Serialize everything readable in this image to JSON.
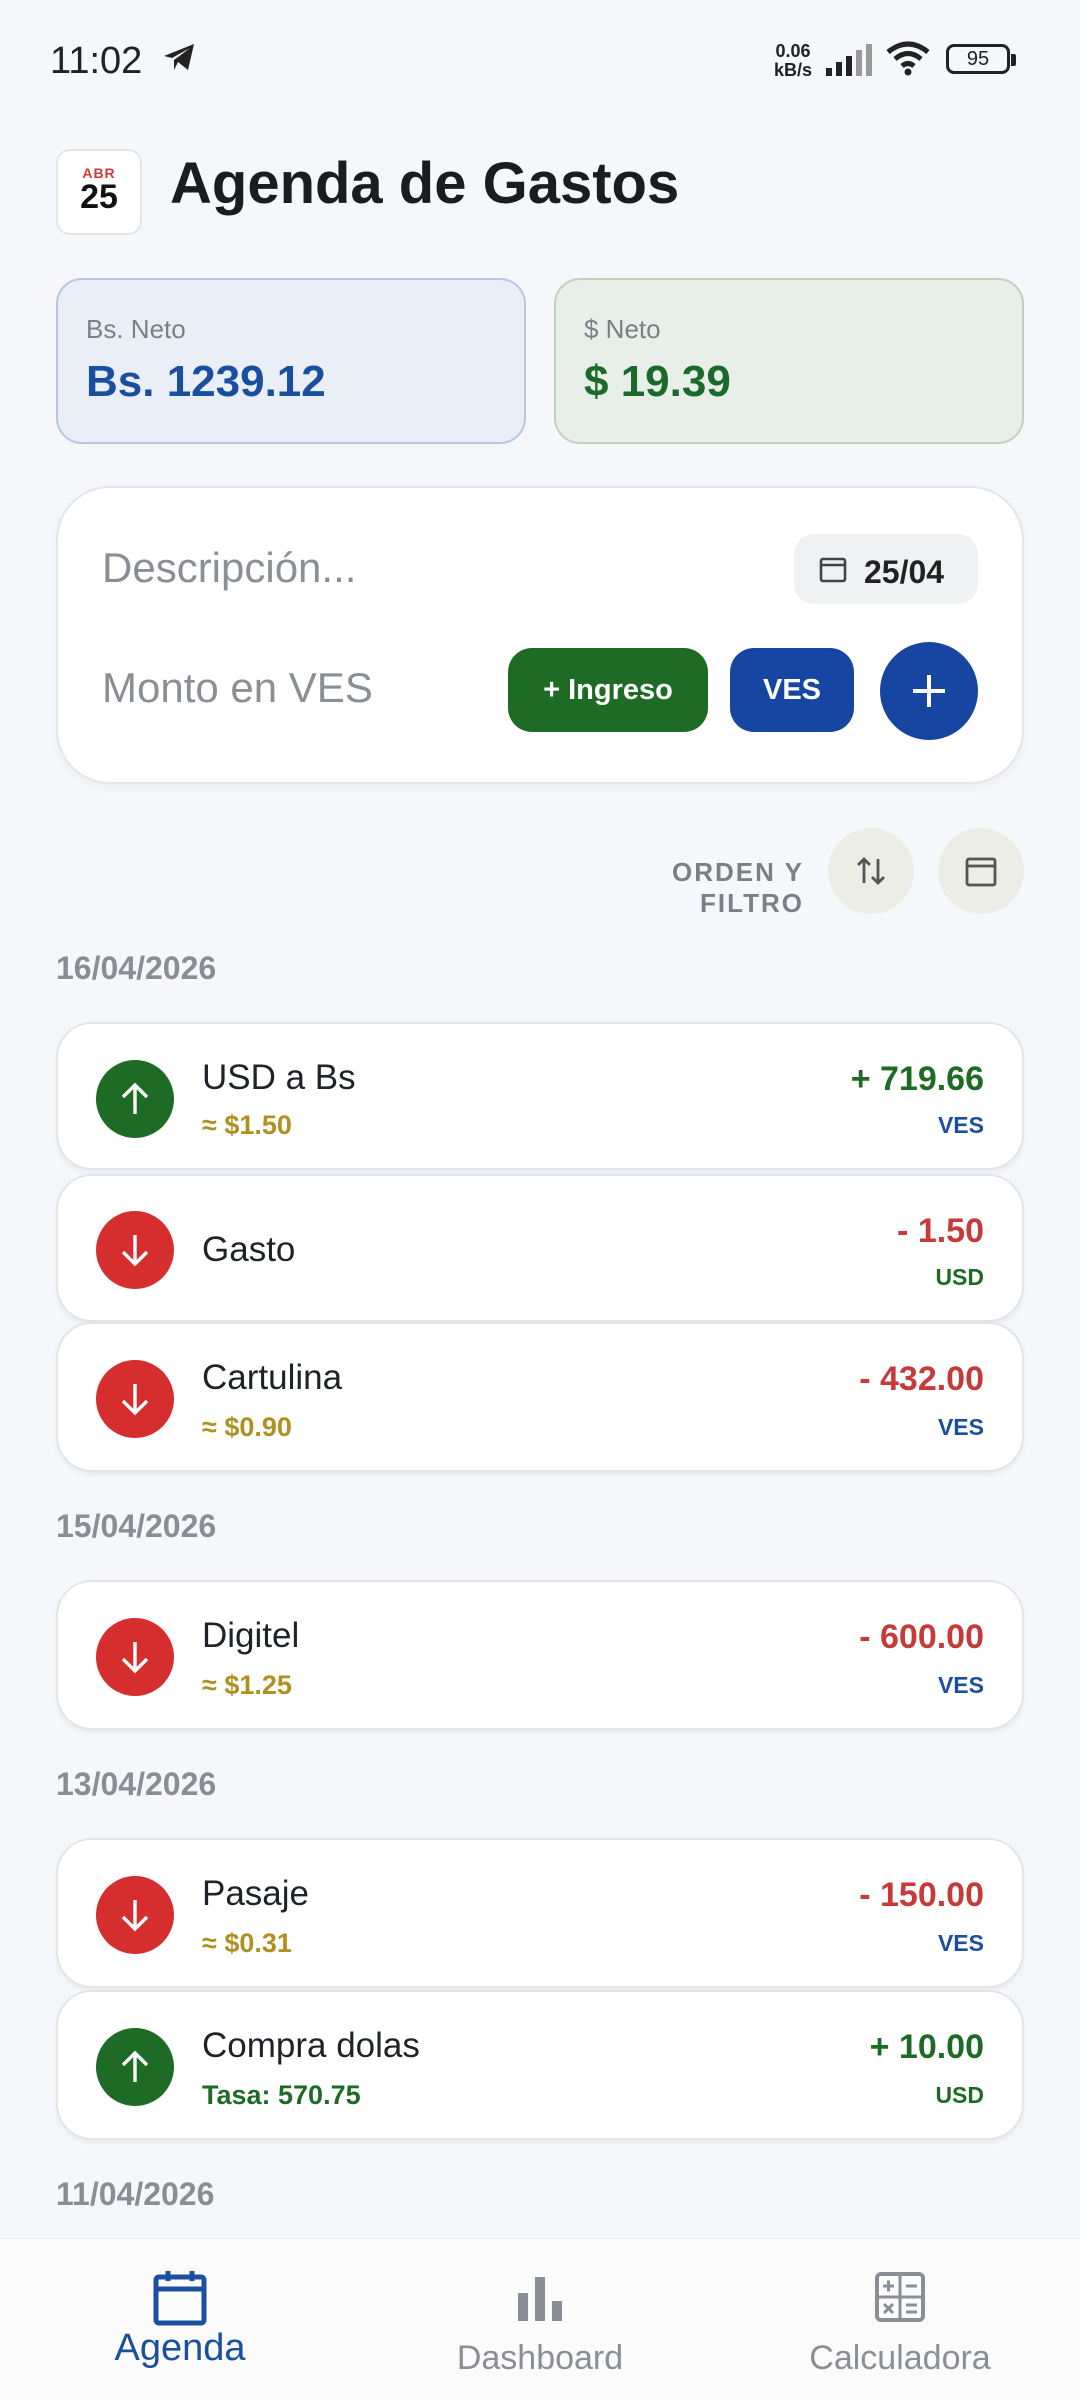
{
  "status_bar": {
    "time": "11:02",
    "net_speed_value": "0.06",
    "net_speed_unit": "kB/s",
    "battery": "95"
  },
  "header": {
    "date_month": "ABR",
    "date_day": "25",
    "title": "Agenda de Gastos"
  },
  "net": {
    "bs_label": "Bs. Neto",
    "bs_value": "Bs. 1239.12",
    "usd_label": "$ Neto",
    "usd_value": "$ 19.39"
  },
  "form": {
    "description_placeholder": "Descripción...",
    "date": "25/04",
    "amount_placeholder": "Monto en VES",
    "type_button": "+ Ingreso",
    "currency_button": "VES"
  },
  "filter": {
    "label": "ORDEN Y FILTRO"
  },
  "groups": [
    {
      "date": "16/04/2026",
      "items": [
        {
          "name": "USD a Bs",
          "sub": "≈ $1.50",
          "amount": "+ 719.66",
          "currency": "VES",
          "direction": "up"
        },
        {
          "name": "Gasto",
          "sub": "",
          "amount": "- 1.50",
          "currency": "USD",
          "direction": "down"
        },
        {
          "name": "Cartulina",
          "sub": "≈ $0.90",
          "amount": "- 432.00",
          "currency": "VES",
          "direction": "down"
        }
      ]
    },
    {
      "date": "15/04/2026",
      "items": [
        {
          "name": "Digitel",
          "sub": "≈ $1.25",
          "amount": "- 600.00",
          "currency": "VES",
          "direction": "down"
        }
      ]
    },
    {
      "date": "13/04/2026",
      "items": [
        {
          "name": "Pasaje",
          "sub": "≈ $0.31",
          "amount": "- 150.00",
          "currency": "VES",
          "direction": "down"
        },
        {
          "name": "Compra dolas",
          "sub": "Tasa: 570.75",
          "amount": "+ 10.00",
          "currency": "USD",
          "direction": "up"
        }
      ]
    },
    {
      "date": "11/04/2026",
      "items": []
    }
  ],
  "nav": {
    "items": [
      {
        "label": "Agenda",
        "icon": "calendar-icon",
        "active": true
      },
      {
        "label": "Dashboard",
        "icon": "bar-chart-icon",
        "active": false
      },
      {
        "label": "Calculadora",
        "icon": "calculator-icon",
        "active": false
      }
    ]
  },
  "colors": {
    "primary_blue": "#1746a2",
    "income_green": "#1e6b25",
    "expense_red": "#d62e2e",
    "approx_gold": "#b09020"
  }
}
